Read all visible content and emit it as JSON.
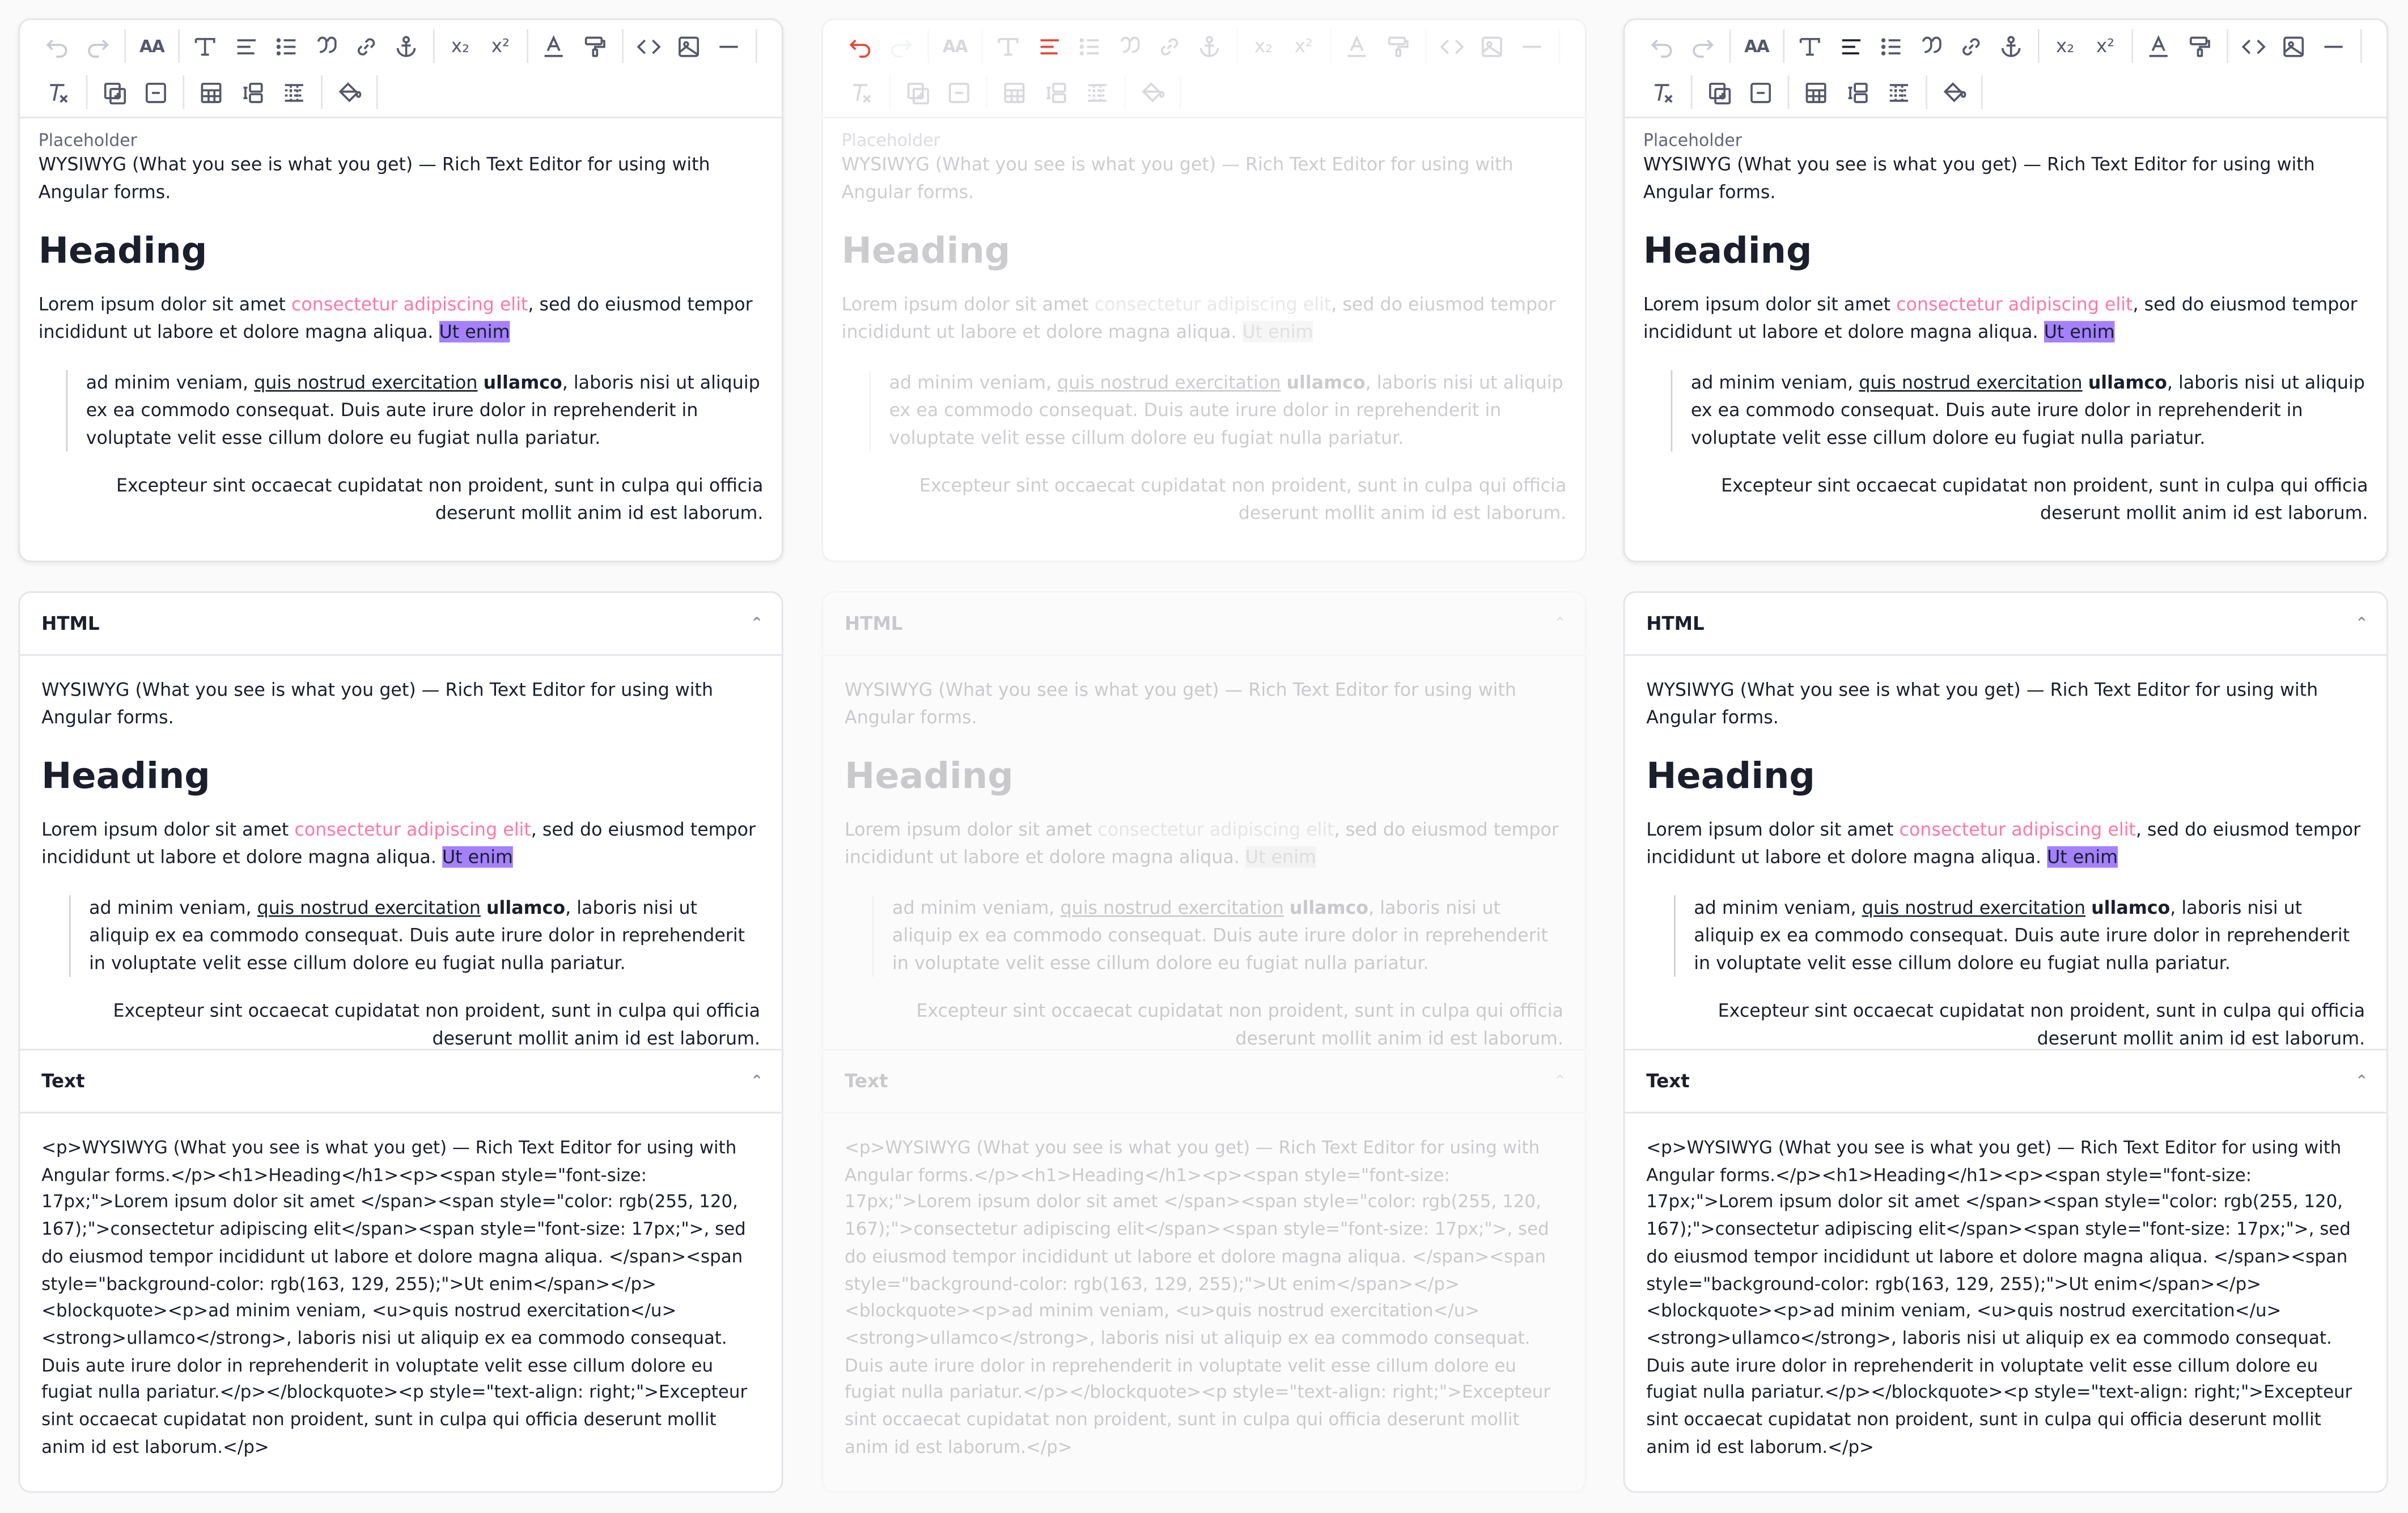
{
  "editor": {
    "placeholder_label": "Placeholder",
    "intro": "WYSIWYG (What you see is what you get) — Rich Text Editor for using with Angular forms.",
    "heading": "Heading",
    "para1_a": "Lorem ipsum dolor sit amet ",
    "para1_pink": "consectetur adipiscing elit",
    "para1_b": ", sed do eiusmod tempor incididunt ut labore et dolore magna aliqua. ",
    "para1_hl": "Ut enim",
    "quote_a": "ad minim veniam, ",
    "quote_u": "quis nostrud exercitation",
    "quote_space": " ",
    "quote_b": "ullamco",
    "quote_c": ", laboris nisi ut aliquip ex ea commodo consequat. Duis aute irure dolor in reprehenderit in voluptate velit esse cillum dolore eu fugiat nulla pariatur.",
    "para2": "Excepteur sint occaecat cupidatat non proident, sunt in culpa qui officia deserunt mollit anim id est laborum."
  },
  "toolbar": {
    "font_size_label": "AA",
    "subscript_label": "x₂",
    "superscript_label": "x²",
    "code_label": "<>"
  },
  "sections": {
    "html_title": "HTML",
    "text_title": "Text",
    "chevron": "⌃"
  },
  "raw_text": "<p>WYSIWYG (What you see is what you get) — Rich Text Editor for using with Angular forms.</p><h1>Heading</h1><p><span style=\"font-size: 17px;\">Lorem ipsum dolor sit amet </span><span style=\"color: rgb(255, 120, 167);\">consectetur adipiscing elit</span><span style=\"font-size: 17px;\">, sed do eiusmod tempor incididunt ut labore et dolore magna aliqua. </span><span style=\"background-color: rgb(163, 129, 255);\">Ut enim</span></p><blockquote><p>ad minim veniam, <u>quis nostrud exercitation</u> <strong>ullamco</strong>, laboris nisi ut aliquip ex ea commodo consequat. Duis aute irure dolor in reprehenderit in voluptate velit esse cillum dolore eu fugiat nulla pariatur.</p></blockquote><p style=\"text-align: right;\">Excepteur sint occaecat cupidatat non proident, sunt in culpa qui officia deserunt mollit anim id est laborum.</p>",
  "colors": {
    "pink": "#ff78a7",
    "highlight": "#a381ff",
    "undo_active": "#e8453c",
    "border": "#e3e4e8"
  }
}
